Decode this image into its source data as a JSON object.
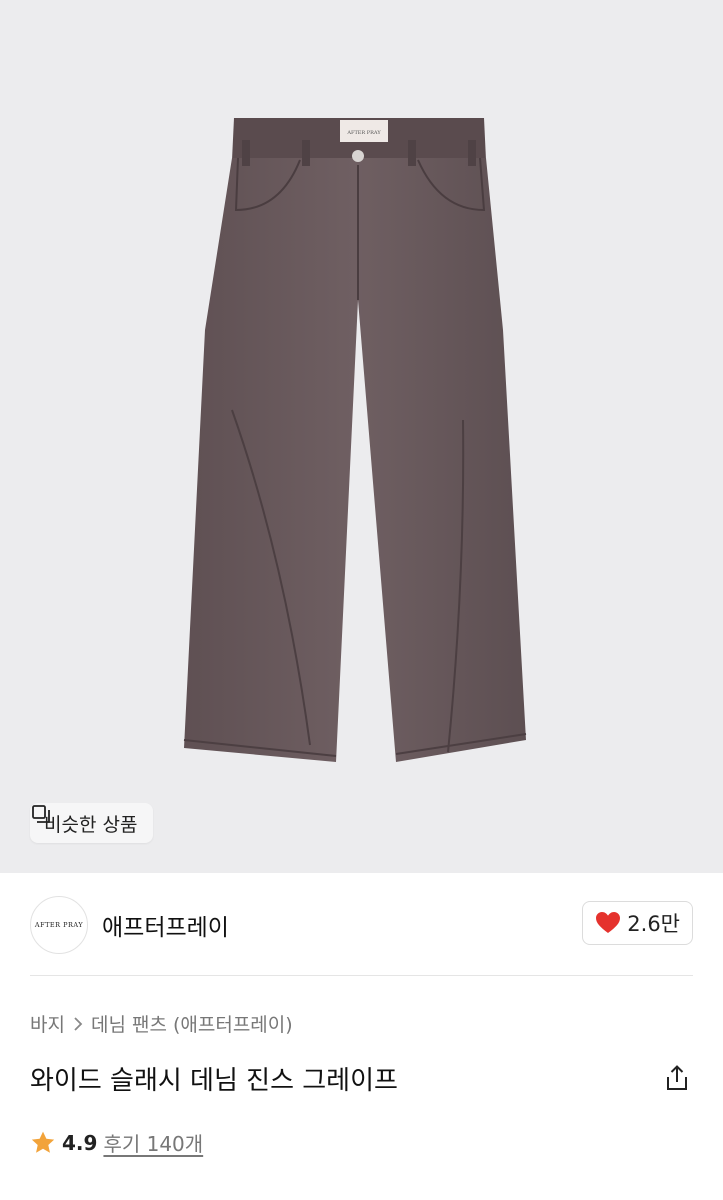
{
  "hero": {
    "image_label": "AFTER PRAY",
    "similar_button_label": "비슷한 상품"
  },
  "brand": {
    "logo_text": "AFTER PRAY",
    "name": "애프터프레이",
    "like_count": "2.6만"
  },
  "breadcrumb": {
    "items": [
      "바지",
      "데님 팬츠 (애프터프레이)"
    ]
  },
  "product": {
    "title": "와이드 슬래시 데님 진스 그레이프"
  },
  "rating": {
    "score": "4.9",
    "reviews_label": "후기 140개"
  },
  "colors": {
    "heart": "#e5322d",
    "star": "#f2a33a",
    "denim": "#6a5a5d"
  }
}
